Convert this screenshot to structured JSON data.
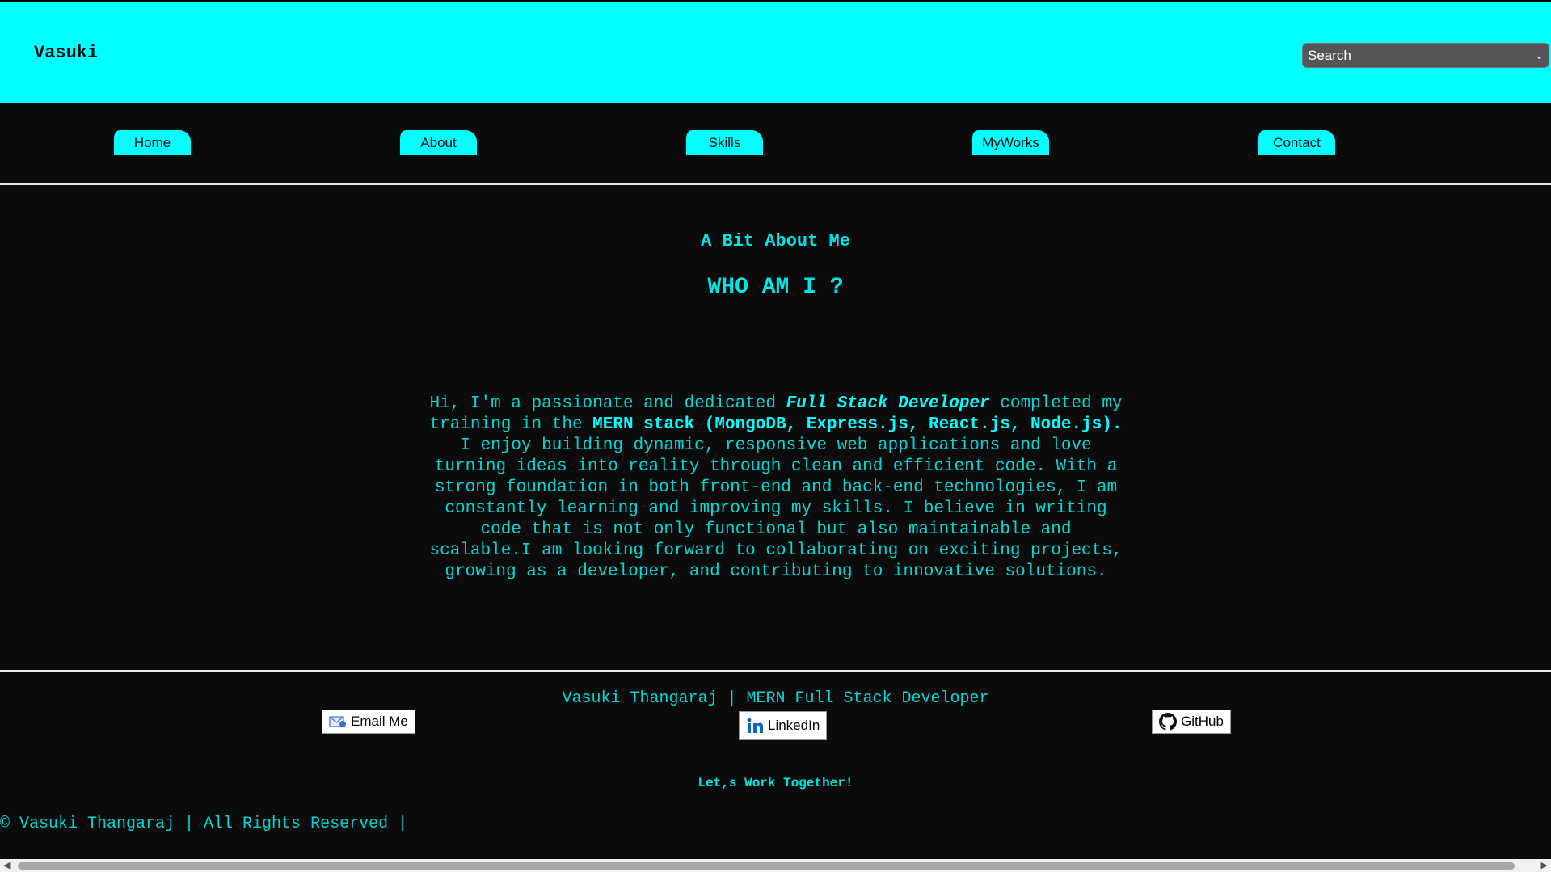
{
  "header": {
    "brand": "Vasuki",
    "search_select": "Search"
  },
  "nav": {
    "items": [
      {
        "label": "Home"
      },
      {
        "label": "About"
      },
      {
        "label": "Skills"
      },
      {
        "label": "MyWorks"
      },
      {
        "label": "Contact"
      }
    ]
  },
  "main": {
    "subtitle": "A Bit About Me",
    "title": "WHO AM I ?",
    "para": {
      "p1": "Hi, I'm a passionate and dedicated ",
      "role": "Full Stack Developer",
      "p2": " completed my training in the ",
      "stack": "MERN stack (MongoDB, Express.js, React.js, Node.js).",
      "p3": " I enjoy building dynamic, responsive web applications and love turning ideas into reality through clean and efficient code. With a strong foundation in both front-end and back-end technologies, I am constantly learning and improving my skills. I believe in writing code that is not only functional but also maintainable and scalable.I am looking forward to collaborating on exciting projects, growing as a developer, and contributing to innovative solutions."
    }
  },
  "footer": {
    "name_line": "Vasuki Thangaraj | MERN Full Stack Developer",
    "email_label": "Email Me",
    "linkedin_label": "LinkedIn",
    "github_label": "GitHub",
    "cta": "Let,s Work Together!",
    "copyright": "© Vasuki Thangaraj | All Rights Reserved |"
  },
  "icons": {
    "email": "mail-icon",
    "linkedin": "linkedin-icon",
    "github": "github-icon",
    "dropdown": "chevron-down-icon"
  },
  "colors": {
    "accent": "#00ffff",
    "background": "#0b0b0b"
  }
}
